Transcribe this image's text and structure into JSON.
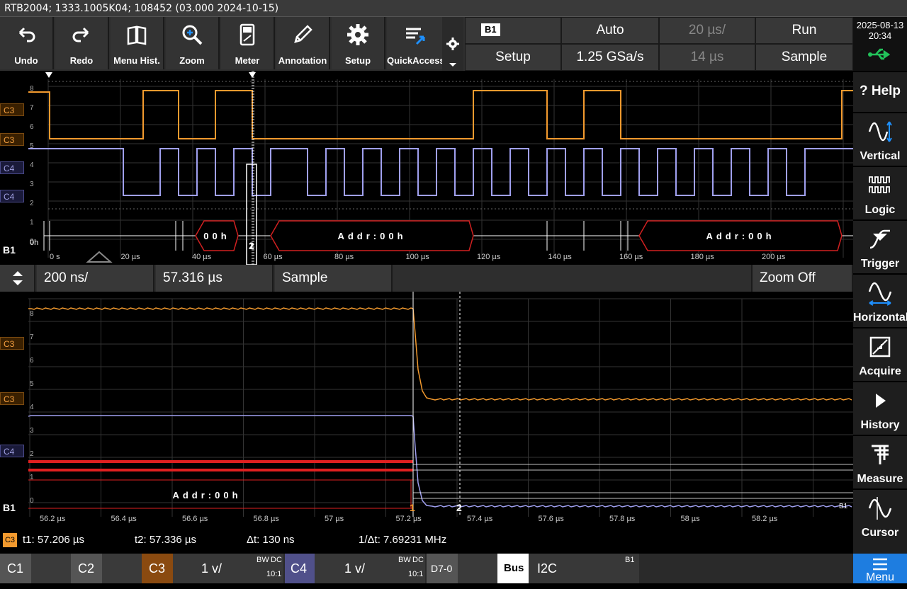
{
  "title": "RTB2004; 1333.1005K04; 108452 (03.000 2024-10-15)",
  "toolbar": {
    "undo": "Undo",
    "redo": "Redo",
    "menu_hist": "Menu Hist.",
    "zoom": "Zoom",
    "meter": "Meter",
    "annotation": "Annotation",
    "setup": "Setup",
    "quick_access": "QuickAccess"
  },
  "trigger_panel": {
    "source": "B1",
    "setup": "Setup",
    "mode": "Auto",
    "sample_rate": "1.25 GSa/s",
    "time_scale": "20 µs/",
    "position": "14 µs",
    "run_state": "Run",
    "acq_mode": "Sample"
  },
  "datetime": {
    "date": "2025-08-13",
    "time": "20:34"
  },
  "right_menu": [
    "? Help",
    "Vertical",
    "Logic",
    "Trigger",
    "Horizontal",
    "Acquire",
    "History",
    "Measure",
    "Cursor"
  ],
  "channel_labels": {
    "c3": "C3",
    "c4": "C4",
    "b1": "B1"
  },
  "upper": {
    "y_ticks": [
      "8",
      "7",
      "6",
      "5",
      "4",
      "3",
      "2",
      "1",
      "0"
    ],
    "x_ticks": [
      "0 s",
      "20 µs",
      "40 µs",
      "60 µs",
      "80 µs",
      "100 µs",
      "120 µs",
      "140 µs",
      "160 µs",
      "180 µs",
      "200 µs"
    ],
    "decode": [
      "00h",
      "Addr:00h",
      "Addr:00h"
    ],
    "bus_left": "0h",
    "cursor_labels": [
      "1",
      "2"
    ]
  },
  "zoom_bar": {
    "scale": "200 ns/",
    "position": "57.316 µs",
    "mode": "Sample",
    "zoom": "Zoom Off"
  },
  "lower": {
    "y_ticks": [
      "8",
      "7",
      "6",
      "5",
      "4",
      "3",
      "2",
      "1",
      "0"
    ],
    "x_ticks": [
      "56.2 µs",
      "56.4 µs",
      "56.6 µs",
      "56.8 µs",
      "57 µs",
      "57.2 µs",
      "57.4 µs",
      "57.6 µs",
      "57.8 µs",
      "58 µs",
      "58.2 µs"
    ],
    "decode": "Addr:00h",
    "b1_tag": "B1",
    "cursor_labels": [
      "1",
      "2"
    ]
  },
  "cursor": {
    "src": "C3",
    "t1": "t1: 57.206 µs",
    "t2": "t2: 57.336 µs",
    "dt": "Δt: 130 ns",
    "inv_dt": "1/Δt: 7.69231 MHz"
  },
  "bottom": {
    "c1": "C1",
    "c2": "C2",
    "c3": "C3",
    "c3_scale": "1 v/",
    "c3_coupling": "DC",
    "c3_bw": "BW",
    "c3_probe": "10:1",
    "c4": "C4",
    "c4_scale": "1 v/",
    "c4_coupling": "DC",
    "c4_bw": "BW",
    "c4_probe": "10:1",
    "d70": "D7-0",
    "bus": "Bus",
    "bus_type": "I2C",
    "bus_id": "B1",
    "menu": "Menu"
  },
  "colors": {
    "c3": "#f39a2e",
    "c4": "#a0a0f0",
    "accent": "#1e90ff",
    "usb": "#22c25a"
  }
}
